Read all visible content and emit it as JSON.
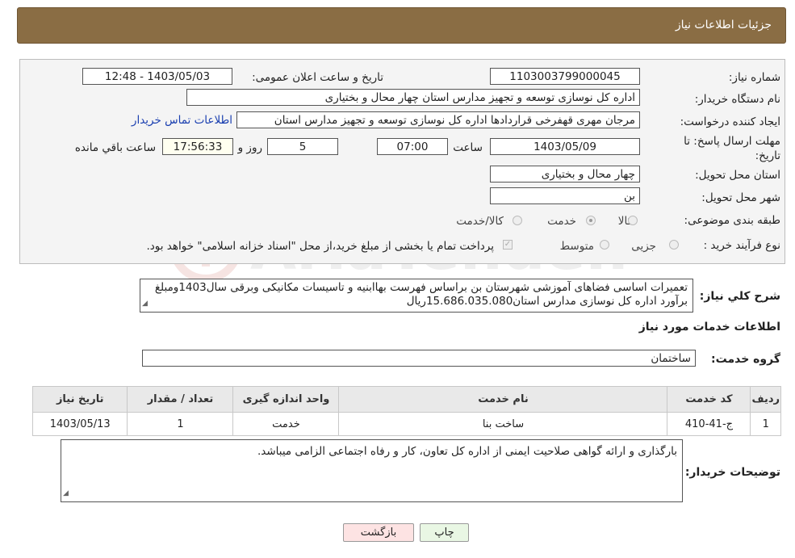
{
  "header": {
    "title": "جزئیات اطلاعات نیاز"
  },
  "watermark": {
    "text": "AriaTender.neT"
  },
  "form": {
    "need_number_label": "شماره نیاز:",
    "need_number": "1103003799000045",
    "announce_label": "تاریخ و ساعت اعلان عمومی:",
    "announce_value": "1403/05/03 - 12:48",
    "buyer_label": "نام دستگاه خریدار:",
    "buyer_value": "اداره کل نوسازی  توسعه و تجهیز مدارس استان چهار محال و بختیاری",
    "creator_label": "ایجاد کننده درخواست:",
    "creator_value": "مرجان مهری قهفرخی قراردادها اداره کل نوسازی  توسعه و تجهیز مدارس استان",
    "contact_link": "اطلاعات تماس خریدار",
    "deadline_label": "مهلت ارسال پاسخ: تا تاریخ:",
    "deadline_date": "1403/05/09",
    "time_label": "ساعت",
    "deadline_time": "07:00",
    "days_value": "5",
    "days_label": "روز و",
    "remaining_time": "17:56:33",
    "remaining_label": "ساعت باقي مانده",
    "province_label": "استان محل تحویل:",
    "province_value": "چهار محال و بختیاری",
    "city_label": "شهر محل تحویل:",
    "city_value": "بن",
    "category_label": "طبقه بندی موضوعی:",
    "category_options": [
      "کالا",
      "خدمت",
      "کالا/خدمت"
    ],
    "category_selected": "خدمت",
    "purchase_label": "نوع فرآیند خرید :",
    "purchase_options": [
      "جزیی",
      "متوسط"
    ],
    "purchase_note": "پرداخت تمام یا بخشی از مبلغ خرید،از محل \"اسناد خزانه اسلامی\" خواهد بود."
  },
  "description": {
    "label": "شرح کلي نياز:",
    "text": "تعمیرات اساسی فضاهای آموزشی شهرستان بن براساس فهرست بهاابنیه و تاسیسات مکانیکی وبرقی سال1403ومبلغ برآورد اداره کل نوسازی مدارس استان15.686.035.080ریال"
  },
  "services": {
    "section_title": "اطلاعات خدمات مورد نياز",
    "group_label": "گروه خدمت:",
    "group_value": "ساختمان",
    "columns": [
      "ردیف",
      "کد خدمت",
      "نام خدمت",
      "واحد اندازه گیری",
      "تعداد / مقدار",
      "تاریخ نیاز"
    ],
    "rows": [
      [
        "1",
        "ج-41-410",
        "ساخت بنا",
        "خدمت",
        "1",
        "1403/05/13"
      ]
    ]
  },
  "buyer_notes": {
    "label": "توضیحات خریدار:",
    "text": "بارگذاری و ارائه گواهی صلاحیت ایمنی از اداره کل تعاون، کار و رفاه اجتماعی الزامی میباشد."
  },
  "buttons": {
    "print": "چاپ",
    "back": "بازگشت"
  }
}
